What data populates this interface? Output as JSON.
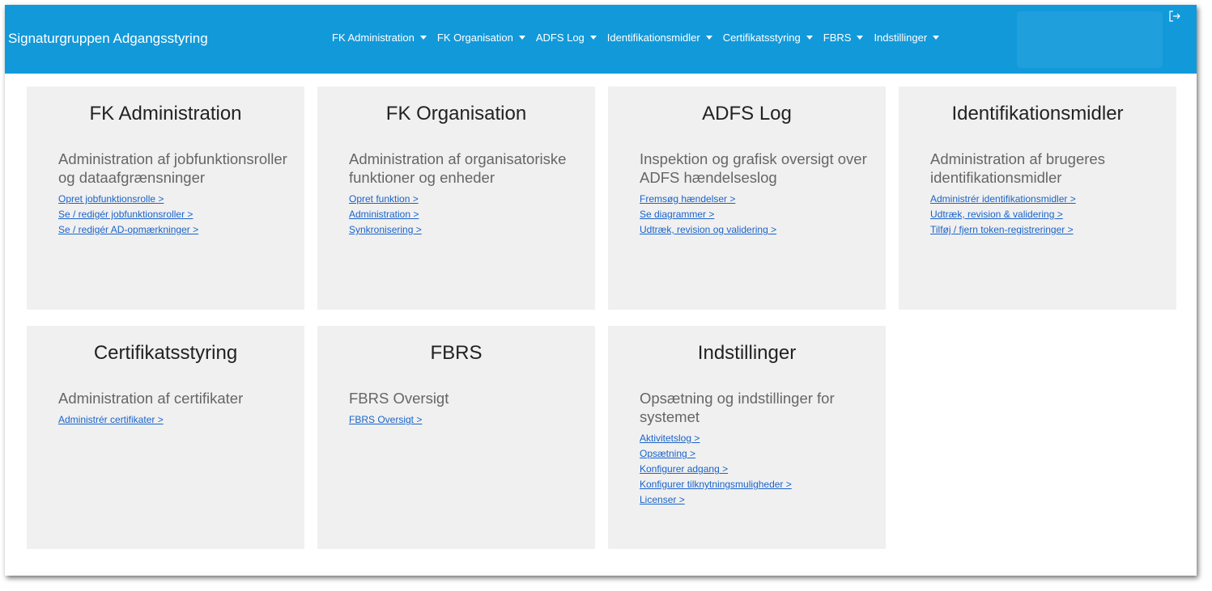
{
  "app": {
    "title": "Signaturgruppen Adgangsstyring"
  },
  "nav": {
    "items": [
      {
        "label": "FK Administration"
      },
      {
        "label": "FK Organisation"
      },
      {
        "label": "ADFS Log"
      },
      {
        "label": "Identifikationsmidler"
      },
      {
        "label": "Certifikatsstyring"
      },
      {
        "label": "FBRS"
      },
      {
        "label": "Indstillinger"
      }
    ],
    "logout_icon": "logout-icon"
  },
  "colors": {
    "navbar": "#1199da",
    "card_bg": "#f0f0f0",
    "link": "#1a63c9"
  },
  "cards": [
    {
      "title": "FK Administration",
      "subtitle": "Administration af jobfunktionsroller og dataafgrænsninger",
      "links": [
        "Opret jobfunktionsrolle >",
        "Se / redigér jobfunktionsroller >",
        "Se / redigér AD-opmærkninger >"
      ]
    },
    {
      "title": "FK Organisation",
      "subtitle": "Administration af organisatoriske funktioner og enheder",
      "links": [
        "Opret funktion >",
        "Administration >",
        "Synkronisering >"
      ]
    },
    {
      "title": "ADFS Log",
      "subtitle": "Inspektion og grafisk oversigt over ADFS hændelseslog",
      "links": [
        "Fremsøg hændelser >",
        "Se diagrammer >",
        "Udtræk, revision og validering >"
      ]
    },
    {
      "title": "Identifikationsmidler",
      "subtitle": "Administration af brugeres identifikationsmidler",
      "links": [
        "Administrér identifikationsmidler >",
        "Udtræk, revision & validering >",
        "Tilføj / fjern token-registreringer >"
      ]
    },
    {
      "title": "Certifikatsstyring",
      "subtitle": "Administration af certifikater",
      "links": [
        "Administrér certifikater >"
      ]
    },
    {
      "title": "FBRS",
      "subtitle": "FBRS Oversigt",
      "links": [
        "FBRS Oversigt >"
      ]
    },
    {
      "title": "Indstillinger",
      "subtitle": "Opsætning og indstillinger for systemet",
      "links": [
        "Aktivitetslog >",
        "Opsætning >",
        "Konfigurer adgang >",
        "Konfigurer tilknytningsmuligheder >",
        "Licenser >"
      ]
    }
  ]
}
